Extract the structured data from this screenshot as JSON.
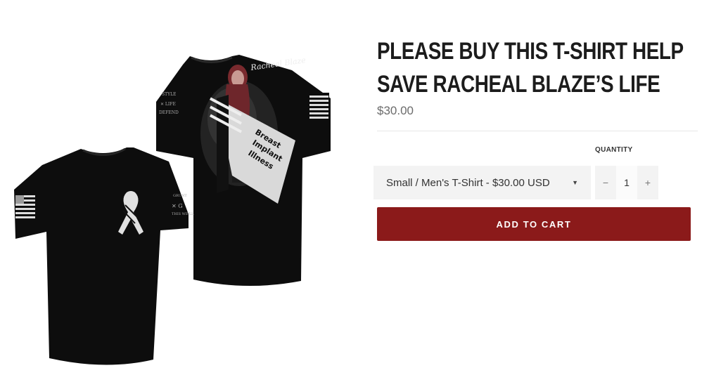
{
  "product": {
    "title_line1": "PLEASE BUY THIS T-SHIRT HELP",
    "title_line2": "SAVE RACHEAL BLAZE’S LIFE",
    "price": "$30.00",
    "image": {
      "back_signature": "Racheal Blaze",
      "ribbon_text": [
        "Breast",
        "Implant",
        "Illness"
      ]
    }
  },
  "form": {
    "quantity_label": "QUANTITY",
    "variant_selected": "Small / Men's T-Shirt - $30.00 USD",
    "quantity_value": "1",
    "decrement_label": "−",
    "increment_label": "+",
    "add_to_cart_label": "ADD TO CART"
  },
  "colors": {
    "button": "#8b1a1a",
    "shirt": "#0d0d0d"
  },
  "icons": {
    "select_caret": "▼"
  }
}
